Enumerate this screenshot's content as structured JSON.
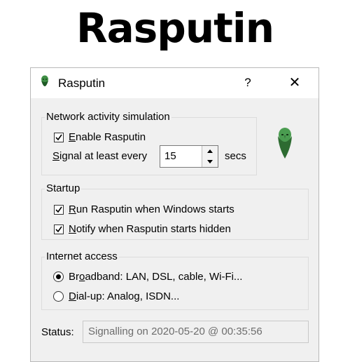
{
  "banner": {
    "title": "Rasputin"
  },
  "window": {
    "title": "Rasputin",
    "help": "?",
    "close": "✕"
  },
  "network": {
    "group_label": "Network activity simulation",
    "enable": {
      "pre": "",
      "u": "E",
      "post": "nable Rasputin",
      "checked": true
    },
    "signal": {
      "pre": "",
      "u": "S",
      "post": "ignal at least every",
      "value": "15",
      "unit": "secs"
    }
  },
  "startup": {
    "group_label": "Startup",
    "run": {
      "pre": "",
      "u": "R",
      "post": "un Rasputin when Windows starts",
      "checked": true
    },
    "notify": {
      "pre": "",
      "u": "N",
      "post": "otify when Rasputin starts hidden",
      "checked": true
    }
  },
  "internet": {
    "group_label": "Internet access",
    "broadband": {
      "pre": "Br",
      "u": "o",
      "post": "adband: LAN, DSL, cable, Wi-Fi...",
      "selected": true
    },
    "dialup": {
      "pre": "",
      "u": "D",
      "post": "ial-up: Analog, ISDN...",
      "selected": false
    }
  },
  "status": {
    "label": "Status:",
    "value": "Signalling on 2020-05-20 @ 00:35:56"
  },
  "icons": {
    "app": "rasputin-portrait-icon",
    "check": "checkmark-icon",
    "spin_up": "triangle-up-icon",
    "spin_down": "triangle-down-icon"
  },
  "colors": {
    "portrait_green": "#2e7d32",
    "window_bg": "#f0f0f0"
  }
}
